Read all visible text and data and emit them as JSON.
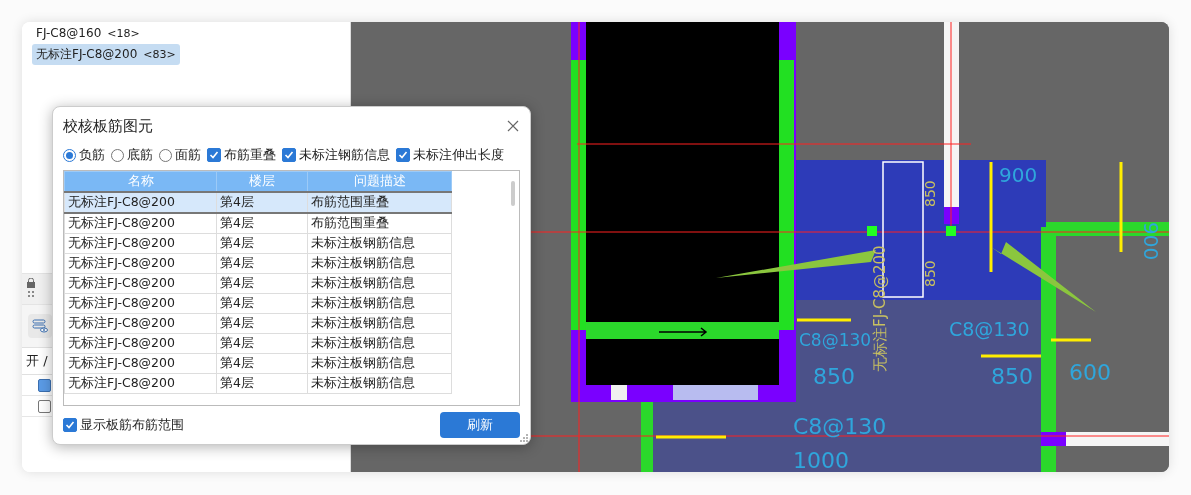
{
  "left_panel": {
    "items": [
      {
        "label": "FJ-C8@160",
        "count": "<18>",
        "selected": false
      },
      {
        "label": "无标注FJ-C8@200",
        "count": "<83>",
        "selected": true
      }
    ],
    "toggle_header": "开 /",
    "layer_checks": [
      {
        "checked": true
      },
      {
        "checked": false
      }
    ]
  },
  "canvas": {
    "labels": [
      {
        "kind": "note",
        "text": "无标注FJ-C8@200"
      },
      {
        "kind": "note",
        "text": "850"
      },
      {
        "kind": "note",
        "text": "850"
      },
      {
        "kind": "dim",
        "text": "900"
      },
      {
        "kind": "dim",
        "text": "900"
      },
      {
        "kind": "dim",
        "text": "C8@130"
      },
      {
        "kind": "dim",
        "text": "C8@130"
      },
      {
        "kind": "dim",
        "text": "850"
      },
      {
        "kind": "dim",
        "text": "850"
      },
      {
        "kind": "dim",
        "text": "600"
      },
      {
        "kind": "dim",
        "text": "C8@130"
      },
      {
        "kind": "dim",
        "text": "1000"
      }
    ]
  },
  "dialog": {
    "title": "校核板筋图元",
    "options": [
      {
        "kind": "radio",
        "label": "负筋",
        "selected": true
      },
      {
        "kind": "radio",
        "label": "底筋",
        "selected": false
      },
      {
        "kind": "radio",
        "label": "面筋",
        "selected": false
      },
      {
        "kind": "checkbox",
        "label": "布筋重叠",
        "checked": true
      },
      {
        "kind": "checkbox",
        "label": "未标注钢筋信息",
        "checked": true
      },
      {
        "kind": "checkbox",
        "label": "未标注伸出长度",
        "checked": true
      }
    ],
    "table": {
      "columns": [
        "名称",
        "楼层",
        "问题描述"
      ],
      "rows": [
        {
          "cells": [
            "无标注FJ-C8@200",
            "第4层",
            "布筋范围重叠"
          ],
          "selected": true
        },
        {
          "cells": [
            "无标注FJ-C8@200",
            "第4层",
            "布筋范围重叠"
          ],
          "selected": false
        },
        {
          "cells": [
            "无标注FJ-C8@200",
            "第4层",
            "未标注板钢筋信息"
          ],
          "selected": false
        },
        {
          "cells": [
            "无标注FJ-C8@200",
            "第4层",
            "未标注板钢筋信息"
          ],
          "selected": false
        },
        {
          "cells": [
            "无标注FJ-C8@200",
            "第4层",
            "未标注板钢筋信息"
          ],
          "selected": false
        },
        {
          "cells": [
            "无标注FJ-C8@200",
            "第4层",
            "未标注板钢筋信息"
          ],
          "selected": false
        },
        {
          "cells": [
            "无标注FJ-C8@200",
            "第4层",
            "未标注板钢筋信息"
          ],
          "selected": false
        },
        {
          "cells": [
            "无标注FJ-C8@200",
            "第4层",
            "未标注板钢筋信息"
          ],
          "selected": false
        },
        {
          "cells": [
            "无标注FJ-C8@200",
            "第4层",
            "未标注板钢筋信息"
          ],
          "selected": false
        },
        {
          "cells": [
            "无标注FJ-C8@200",
            "第4层",
            "未标注板钢筋信息"
          ],
          "selected": false
        }
      ]
    },
    "show_range": {
      "label": "显示板筋布筋范围",
      "checked": true
    },
    "refresh_button": "刷新"
  }
}
